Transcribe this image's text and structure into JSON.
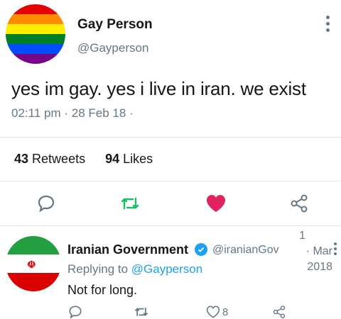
{
  "tweet": {
    "author_name": "Gay Person",
    "author_handle": "@Gayperson",
    "text": "yes im gay. yes i live in iran. we exist",
    "time": "02:11 pm",
    "dot": "·",
    "date": "28 Feb 18",
    "dot2": "·",
    "retweets_count": "43",
    "retweets_label": "Retweets",
    "likes_count": "94",
    "likes_label": "Likes",
    "avatar": "rainbow-flag",
    "like_color": "#e0245e",
    "accent_color": "#1da1f2",
    "actions": [
      "reply-icon",
      "retweet-icon",
      "like-icon",
      "share-icon"
    ]
  },
  "reply": {
    "author_name": "Iranian Government",
    "author_handle": "@iranianGov",
    "date_line1": "· Mar",
    "date_top": "1",
    "date_line2": "2018",
    "replying_prefix": "Replying to",
    "replying_handle": "@Gayperson",
    "text": "Not for long.",
    "avatar": "iran-flag",
    "likes": "8",
    "verified": true
  }
}
